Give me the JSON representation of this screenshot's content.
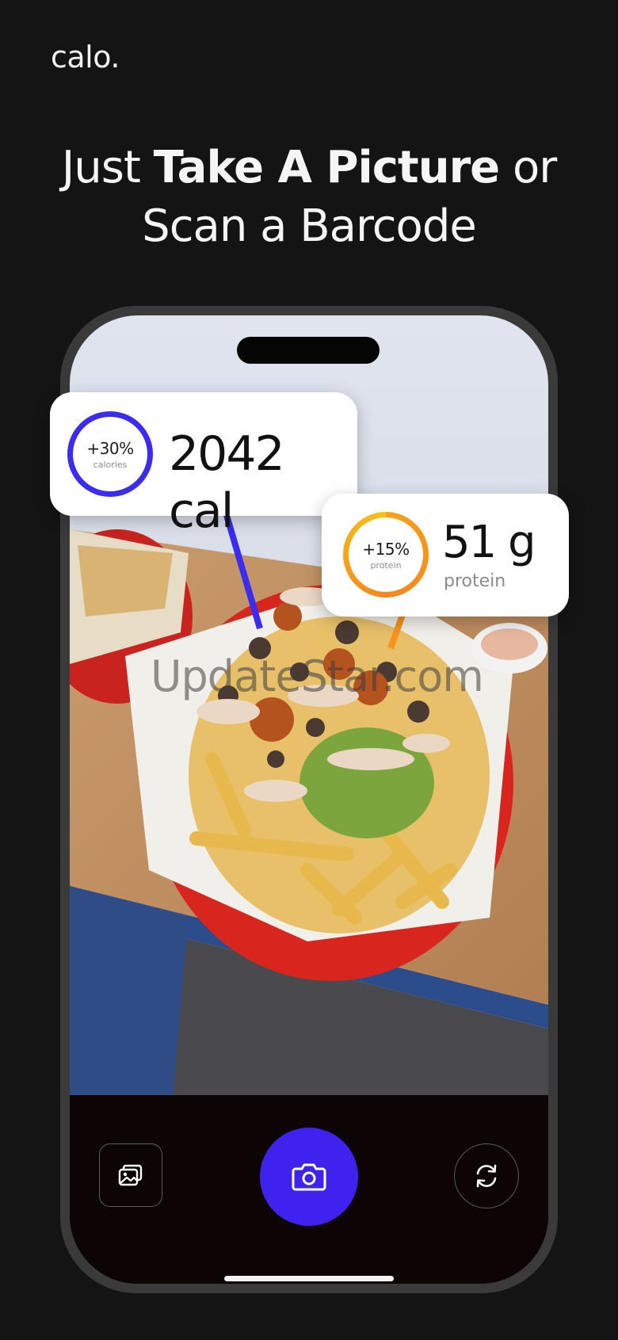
{
  "brand": "calo.",
  "headline": {
    "line1_before": "Just ",
    "line1_bold": "Take A Picture",
    "line1_after": " or",
    "line2": "Scan a Barcode"
  },
  "cards": {
    "calories": {
      "percent": "+30%",
      "ring_label": "calories",
      "value": "2042 cal",
      "color": "#3b2cf0"
    },
    "protein": {
      "percent": "+15%",
      "ring_label": "protein",
      "value": "51 g",
      "label": "protein",
      "color": "#f5941e"
    }
  },
  "camera": {
    "gallery_icon": "gallery-icon",
    "shutter_icon": "camera-icon",
    "flip_icon": "flip-camera-icon",
    "shutter_color": "#3f22ee"
  },
  "watermark": "UpdateStar.com"
}
